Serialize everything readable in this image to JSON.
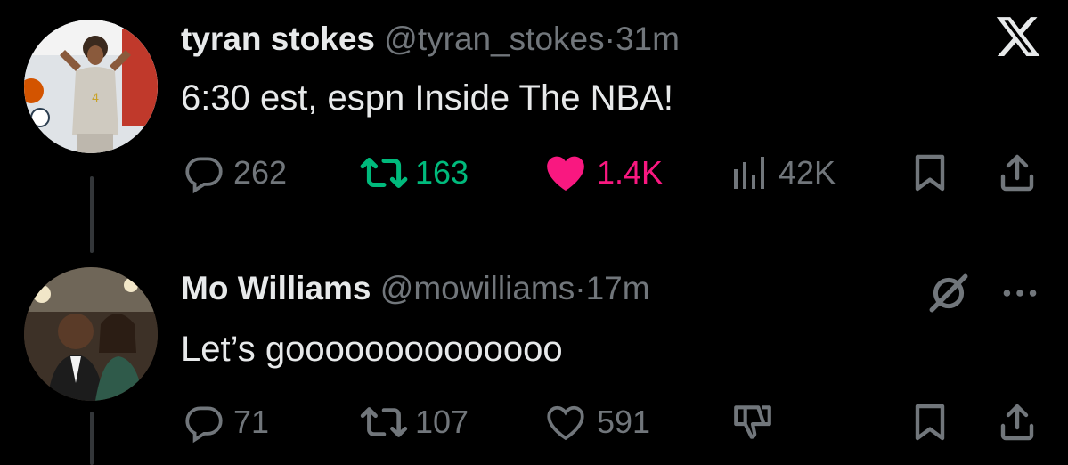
{
  "tweets": [
    {
      "name": "tyran stokes",
      "handle": "@tyran_stokes",
      "separator": "·",
      "time": "31m",
      "text": "6:30 est, espn Inside The NBA!",
      "replies": "262",
      "retweets": "163",
      "likes": "1.4K",
      "views": "42K",
      "avatar_colors": {
        "bg": "#e9ecef",
        "jersey": "#cfcac0",
        "accent": "#c0392b"
      },
      "retweeted": true,
      "liked": true
    },
    {
      "name": "Mo Williams",
      "handle": "@mowilliams",
      "separator": "·",
      "time": "17m",
      "text": "Let’s goooooooooooooo",
      "replies": "71",
      "retweets": "107",
      "likes": "591",
      "avatar_colors": {
        "bg": "#4a3b2c",
        "skin": "#6b4a34",
        "suit": "#1c1c1c"
      },
      "retweeted": false,
      "liked": false
    }
  ],
  "colors": {
    "background": "#000000",
    "text": "#e7e9ea",
    "muted": "#71767b",
    "retweet": "#00ba7c",
    "like": "#f91880",
    "thread_line": "#333639"
  },
  "icons": {
    "close": "x-logo-icon",
    "reply": "reply-icon",
    "retweet": "retweet-icon",
    "like": "heart-icon",
    "views": "views-icon",
    "bookmark": "bookmark-icon",
    "share": "share-icon",
    "grok": "grok-icon",
    "more": "more-icon",
    "dislike": "downvote-icon"
  }
}
